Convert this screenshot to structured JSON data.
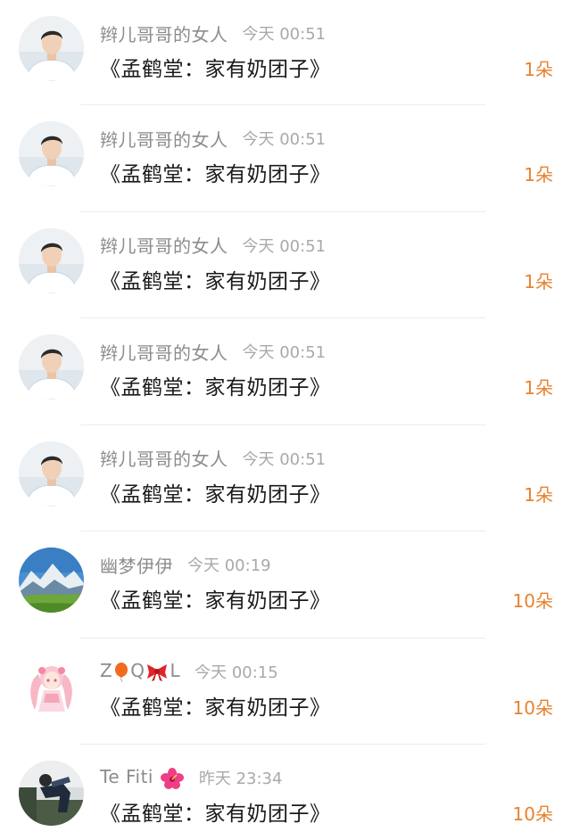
{
  "colors": {
    "background": "#ffffff",
    "username": "#8c8c8c",
    "time": "#a9a9a9",
    "title": "#1a1a1a",
    "count_accent": "#e6822e",
    "divider": "#ececec"
  },
  "items": [
    {
      "username": "辫儿哥哥的女人",
      "time": "今天 00:51",
      "title": "《孟鹤堂：家有奶团子》",
      "count": "1朵",
      "avatar": "man-portrait-avatar"
    },
    {
      "username": "辫儿哥哥的女人",
      "time": "今天 00:51",
      "title": "《孟鹤堂：家有奶团子》",
      "count": "1朵",
      "avatar": "man-portrait-avatar"
    },
    {
      "username": "辫儿哥哥的女人",
      "time": "今天 00:51",
      "title": "《孟鹤堂：家有奶团子》",
      "count": "1朵",
      "avatar": "man-portrait-avatar"
    },
    {
      "username": "辫儿哥哥的女人",
      "time": "今天 00:51",
      "title": "《孟鹤堂：家有奶团子》",
      "count": "1朵",
      "avatar": "man-portrait-avatar"
    },
    {
      "username": "辫儿哥哥的女人",
      "time": "今天 00:51",
      "title": "《孟鹤堂：家有奶团子》",
      "count": "1朵",
      "avatar": "man-portrait-avatar"
    },
    {
      "username": "幽梦伊伊",
      "time": "今天 00:19",
      "title": "《孟鹤堂：家有奶团子》",
      "count": "10朵",
      "avatar": "mountain-landscape-avatar"
    },
    {
      "username_parts": [
        "Z",
        "Q",
        "L"
      ],
      "username_emojis": [
        "balloon-emoji",
        "ribbon-emoji"
      ],
      "time": "今天 00:15",
      "title": "《孟鹤堂：家有奶团子》",
      "count": "10朵",
      "avatar": "anime-girl-avatar"
    },
    {
      "username": "Te Fiti",
      "username_emojis": [
        "hibiscus-emoji"
      ],
      "time": "昨天 23:34",
      "title": "《孟鹤堂：家有奶团子》",
      "count": "10朵",
      "avatar": "person-sitting-avatar"
    }
  ]
}
